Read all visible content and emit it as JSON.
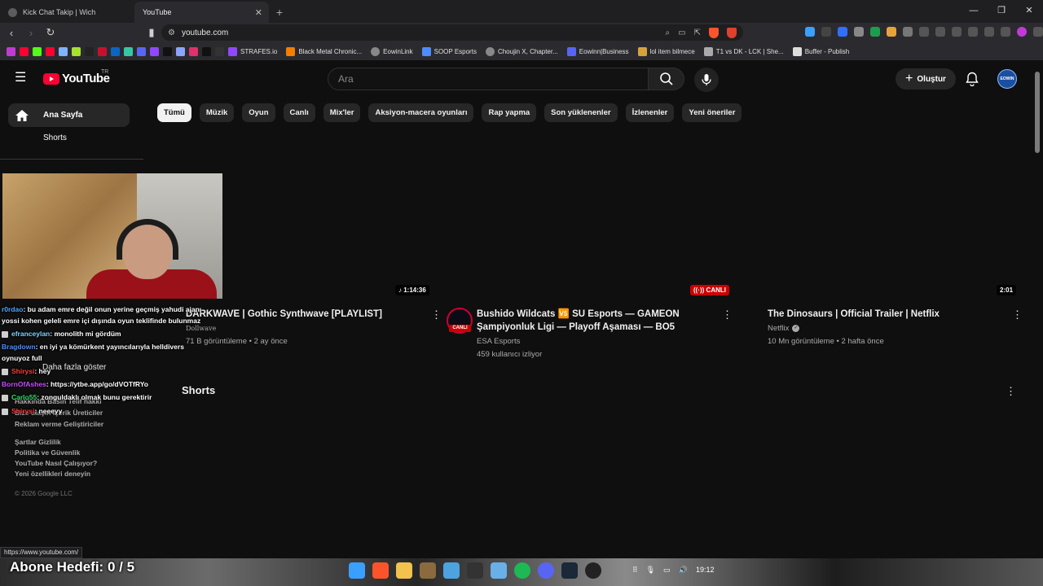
{
  "browser": {
    "tabs": [
      {
        "title": "Kick Chat Takip | Wich"
      },
      {
        "title": "YouTube"
      }
    ],
    "url": "youtube.com",
    "bookmarks": [
      "STRAFES.io",
      "Black Metal Chronic...",
      "EowinLink",
      "SOOP Esports",
      "Choujin X, Chapter...",
      "Eowinn|Business",
      "lol item bilmece",
      "T1 vs DK - LCK | She...",
      "Buffer - Publish"
    ],
    "status_url": "https://www.youtube.com/"
  },
  "youtube": {
    "logo_text": "YouTube",
    "country_code": "TR",
    "search_placeholder": "Ara",
    "create_label": "Oluştur",
    "avatar_text": "EOWIN",
    "sidebar": {
      "home": "Ana Sayfa",
      "shorts": "Shorts",
      "show_more": "Daha fazla göster"
    },
    "chips": [
      "Tümü",
      "Müzik",
      "Oyun",
      "Canlı",
      "Mix'ler",
      "Aksiyon-macera oyunları",
      "Rap yapma",
      "Son yüklenenler",
      "İzlenenler",
      "Yeni öneriler"
    ],
    "videos": [
      {
        "title": "DARKWAVE | Gothic Synthwave [PLAYLIST]",
        "channel": "Dollwave",
        "meta": "71 B görüntüleme • 2 ay önce",
        "badge": "♪ 1:14:36"
      },
      {
        "title_line1": "Bushido Wildcats 🆚 SU Esports — GAMEON",
        "title_line2": "Şampiyonluk Ligi — Playoff Aşaması — BO5",
        "channel": "ESA Esports",
        "meta": "459 kullanıcı izliyor",
        "badge": "((·)) CANLI",
        "avatar_live": "CANLI"
      },
      {
        "title": "The Dinosaurs | Official Trailer | Netflix",
        "channel": "Netflix",
        "meta": "10 Mn görüntüleme • 2 hafta önce",
        "badge": "2:01"
      }
    ],
    "shorts_heading": "Shorts",
    "footer": {
      "line1": "Hakkında  Basın  Telif hakkı",
      "line2": "Bize ulaşın  İçerik Üreticiler",
      "line3": "Reklam verme  Geliştiriciler",
      "line4": "Şartlar  Gizlilik",
      "line5": "Politika ve Güvenlik",
      "line6": "YouTube Nasıl Çalışıyor?",
      "line7": "Yeni özellikleri deneyin",
      "copyright": "© 2026 Google LLC"
    }
  },
  "chat": [
    {
      "user": "r0rdao",
      "color": "#4da6ff",
      "text": ": bu adam emre değil onun yerine geçmiş yahudi ajanı"
    },
    {
      "user": "",
      "color": "#ffffff",
      "text": "yossi kohen geleli emre içi dışında oyun teklifinde bulunmaz"
    },
    {
      "user": "efranceylan",
      "color": "#7fd1ff",
      "text": ": monolith mi gördüm"
    },
    {
      "user": "Bragdown",
      "color": "#4d8cff",
      "text": ": en iyi ya kömürkent yayıncılarıyla helldivers"
    },
    {
      "user": "",
      "color": "#ffffff",
      "text": "oynuyoz full"
    },
    {
      "user": "Shirysi",
      "color": "#ff3b3b",
      "text": ": hey"
    },
    {
      "user": "BornOfAshes",
      "color": "#c84dff",
      "text": ": https://ytbe.app/go/dVOTfRYo"
    },
    {
      "user": "Carlo55",
      "color": "#36d96b",
      "text": ": zonguldaklı olmak bunu gerektirir"
    },
    {
      "user": "Shirysi",
      "color": "#ff3b3b",
      "text": ": neeeyy"
    }
  ],
  "overlay": {
    "goal_label": "Abone Hedefi:",
    "goal_value": "0 / 5"
  },
  "taskbar": {
    "clock": "19:12"
  }
}
